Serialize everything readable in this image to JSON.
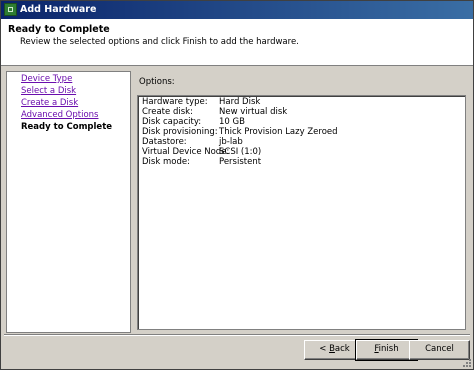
{
  "window": {
    "title": "Add Hardware"
  },
  "header": {
    "title": "Ready to Complete",
    "subtitle": "Review the selected options and click Finish to add the hardware."
  },
  "nav": {
    "items": [
      {
        "label": "Device Type",
        "state": "link"
      },
      {
        "label": "Select a Disk",
        "state": "link"
      },
      {
        "label": "Create a Disk",
        "state": "link"
      },
      {
        "label": "Advanced Options",
        "state": "link"
      },
      {
        "label": "Ready to Complete",
        "state": "current"
      }
    ]
  },
  "options": {
    "label": "Options:",
    "rows": [
      {
        "key": "Hardware type:",
        "value": "Hard Disk"
      },
      {
        "key": "Create disk:",
        "value": "New virtual disk"
      },
      {
        "key": "Disk capacity:",
        "value": "10 GB"
      },
      {
        "key": "Disk provisioning:",
        "value": "Thick Provision Lazy Zeroed"
      },
      {
        "key": "Datastore:",
        "value": "jb-lab"
      },
      {
        "key": "Virtual Device Node:",
        "value": "SCSI (1:0)"
      },
      {
        "key": "Disk mode:",
        "value": "Persistent"
      }
    ]
  },
  "buttons": {
    "back": {
      "pre": "< ",
      "mnemonic": "B",
      "post": "ack"
    },
    "finish": {
      "pre": "",
      "mnemonic": "F",
      "post": "inish"
    },
    "cancel": {
      "pre": "Cancel",
      "mnemonic": "",
      "post": ""
    }
  },
  "colors": {
    "titlebar_start": "#0a246a",
    "titlebar_end": "#3a6ea5",
    "link": "#6a0dad",
    "dialog_face": "#d4d0c8"
  }
}
